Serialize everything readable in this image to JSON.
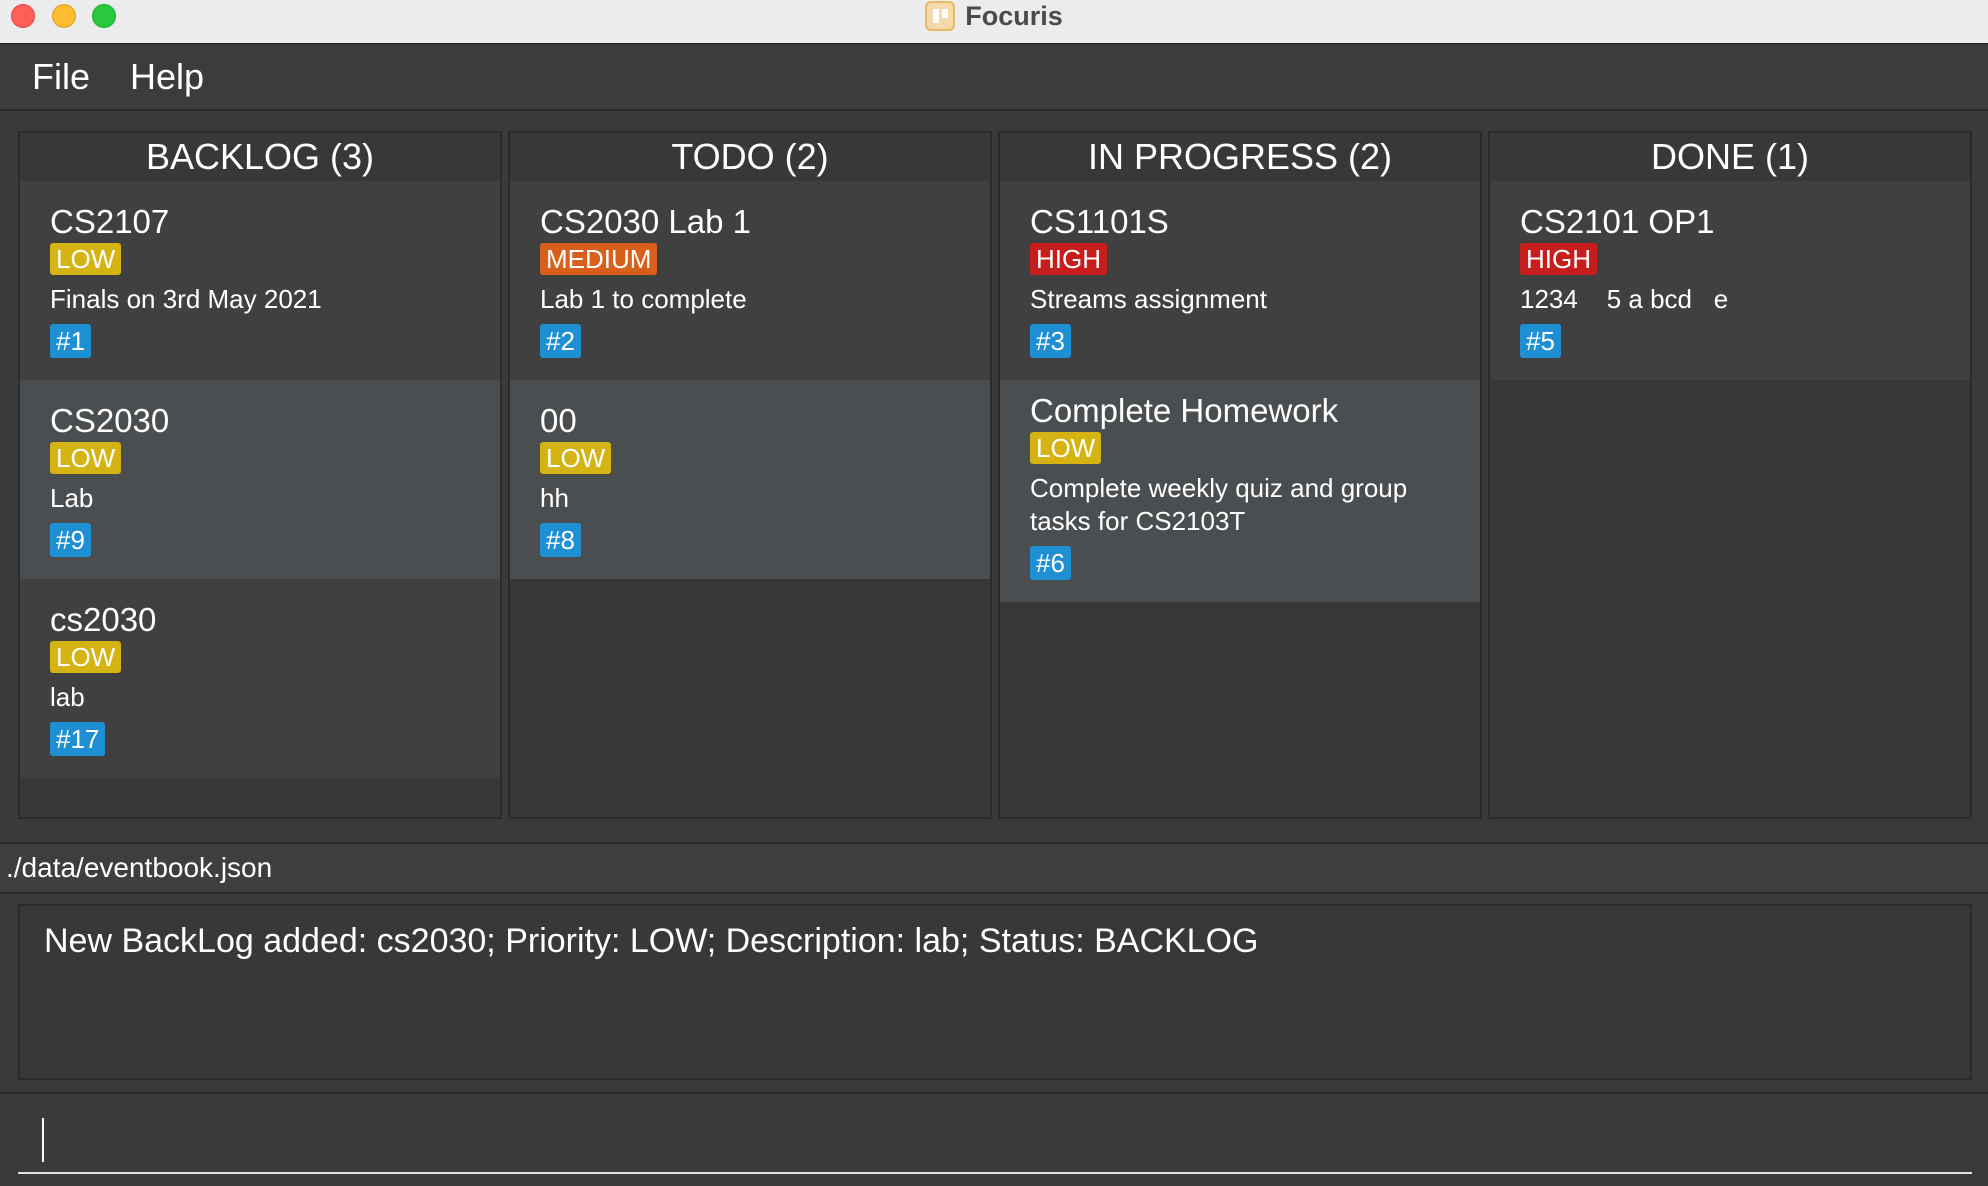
{
  "window": {
    "title": "Focuris"
  },
  "menu": {
    "file": "File",
    "help": "Help"
  },
  "columns": [
    {
      "header": "BACKLOG (3)",
      "cards": [
        {
          "title": "CS2107",
          "priority": "LOW",
          "description": "Finals on 3rd May 2021",
          "id": "#1"
        },
        {
          "title": "CS2030",
          "priority": "LOW",
          "description": "Lab",
          "id": "#9"
        },
        {
          "title": "cs2030",
          "priority": "LOW",
          "description": "lab",
          "id": "#17"
        }
      ]
    },
    {
      "header": "TODO (2)",
      "cards": [
        {
          "title": "CS2030 Lab 1",
          "priority": "MEDIUM",
          "description": "Lab 1 to complete",
          "id": "#2"
        },
        {
          "title": "00",
          "priority": "LOW",
          "description": "hh",
          "id": "#8"
        }
      ]
    },
    {
      "header": "IN PROGRESS (2)",
      "cards": [
        {
          "title": "CS1101S",
          "priority": "HIGH",
          "description": "Streams assignment",
          "id": "#3"
        },
        {
          "title": "Complete Homework",
          "priority": "LOW",
          "description": "Complete weekly quiz and group tasks for CS2103T",
          "id": "#6"
        }
      ]
    },
    {
      "header": "DONE (1)",
      "cards": [
        {
          "title": "CS2101 OP1",
          "priority": "HIGH",
          "description": "1234    5 a bcd   e",
          "id": "#5"
        }
      ]
    }
  ],
  "status_bar": {
    "path": "./data/eventbook.json"
  },
  "result_display": {
    "text": "New BackLog added: cs2030; Priority: LOW; Description: lab; Status: BACKLOG"
  },
  "command_box": {
    "value": ""
  },
  "colors": {
    "priority_low": "#d4b312",
    "priority_medium": "#d9601c",
    "priority_high": "#c81d1d",
    "id_tag": "#1f8fd4"
  }
}
